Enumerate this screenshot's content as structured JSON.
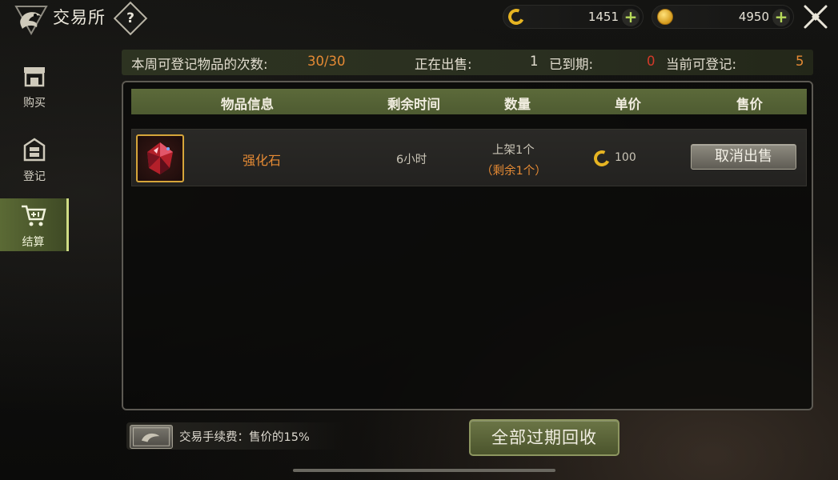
{
  "header": {
    "title": "交易所",
    "help_label": "?",
    "currency_1": {
      "icon": "c-coin-icon",
      "value": "1451"
    },
    "currency_2": {
      "icon": "gold-coin-icon",
      "value": "4950"
    },
    "close_icon": "close-icon"
  },
  "sidebar": {
    "items": [
      {
        "label": "购买",
        "icon": "shop-icon"
      },
      {
        "label": "登记",
        "icon": "register-icon"
      },
      {
        "label": "结算",
        "icon": "cart-icon",
        "active": true
      }
    ]
  },
  "summary": {
    "weekly_label": "本周可登记物品的次数:",
    "weekly_value": "30/30",
    "selling_label": "正在出售:",
    "selling_value": "1",
    "expired_label": "已到期:",
    "expired_value": "0",
    "available_label": "当前可登记:",
    "available_value": "5"
  },
  "table": {
    "headers": [
      "物品信息",
      "剩余时间",
      "数量",
      "单价",
      "售价"
    ],
    "rows": [
      {
        "icon": "red-gem-icon",
        "name": "强化石",
        "time_left": "6小时",
        "qty_listed": "上架1个",
        "qty_remaining": "（剩余1个）",
        "unit_price": "100",
        "action": "取消出售"
      }
    ]
  },
  "footer": {
    "fee_text": "交易手续费：售价的15%",
    "recover_button": "全部过期回收"
  },
  "colors": {
    "accent_orange": "#e58a34",
    "header_green": "#5c6a3a",
    "expired_red": "#d23a2a",
    "plus_green": "#b6d95a",
    "coin_gold": "#e6b422"
  }
}
